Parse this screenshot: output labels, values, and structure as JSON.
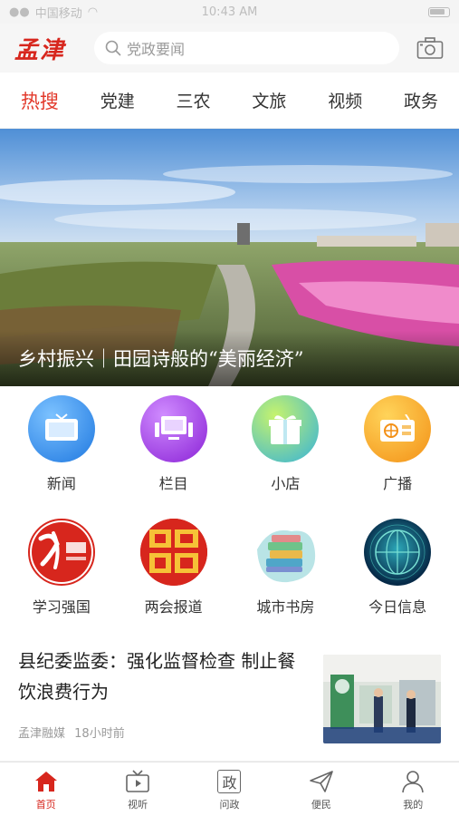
{
  "status_bar": {
    "carrier": "中国移动",
    "time": "10:43 AM"
  },
  "header": {
    "logo_text": "孟津",
    "search_placeholder": "党政要闻"
  },
  "tabs": [
    {
      "label": "热搜",
      "active": true
    },
    {
      "label": "党建"
    },
    {
      "label": "三农"
    },
    {
      "label": "文旅"
    },
    {
      "label": "视频"
    },
    {
      "label": "政务"
    }
  ],
  "hero": {
    "caption": "乡村振兴｜田园诗般的“美丽经济”"
  },
  "grid_row1": [
    {
      "label": "新闻",
      "icon": "tv-icon",
      "color": "#2f8ff0"
    },
    {
      "label": "栏目",
      "icon": "monitor-icon",
      "color": "#9b37e2"
    },
    {
      "label": "小店",
      "icon": "gift-icon",
      "color": "#6bd04a"
    },
    {
      "label": "广播",
      "icon": "radio-icon",
      "color": "#f6a51c"
    }
  ],
  "grid_row2": [
    {
      "label": "学习强国",
      "icon": "xuexi-logo",
      "color": "#d7261d"
    },
    {
      "label": "两会报道",
      "icon": "lianghui-logo",
      "color": "#d7261d"
    },
    {
      "label": "城市书房",
      "icon": "books-icon",
      "color": "#7cc6c9"
    },
    {
      "label": "今日信息",
      "icon": "globe-icon",
      "color": "#0b3a5e"
    }
  ],
  "news": {
    "title": "县纪委监委：强化监督检查 制止餐饮浪费行为",
    "source": "孟津融媒",
    "time": "18小时前"
  },
  "bottom_nav": [
    {
      "label": "首页",
      "icon": "home-icon",
      "active": true
    },
    {
      "label": "视听",
      "icon": "tv-icon"
    },
    {
      "label": "问政",
      "icon": "zheng-icon",
      "glyph": "政"
    },
    {
      "label": "便民",
      "icon": "send-icon"
    },
    {
      "label": "我的",
      "icon": "user-icon"
    }
  ],
  "colors": {
    "accent": "#d7261d",
    "tab_active": "#e2392b"
  }
}
